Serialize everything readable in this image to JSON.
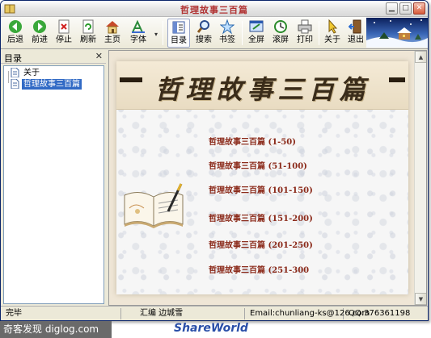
{
  "window": {
    "title": "哲理故事三百篇"
  },
  "toolbar": {
    "back": "后退",
    "forward": "前进",
    "stop": "停止",
    "refresh": "刷新",
    "home": "主页",
    "font": "字体",
    "toc": "目录",
    "search": "搜索",
    "bookmark": "书签",
    "fullscreen": "全屏",
    "autoscroll": "滚屏",
    "print": "打印",
    "about": "关于",
    "exit": "退出"
  },
  "sidebar": {
    "title": "目录",
    "items": [
      {
        "label": "关于"
      },
      {
        "label": "哲理故事三百篇"
      }
    ]
  },
  "content": {
    "banner_title": "哲理故事三百篇",
    "links": [
      "哲理故事三百篇 (1-50)",
      "哲理故事三百篇 (51-100)",
      "哲理故事三百篇 (101-150)",
      "哲理故事三百篇 (151-200)",
      "哲理故事三百篇 (201-250)",
      "哲理故事三百篇 (251-300"
    ]
  },
  "status": {
    "state": "完毕",
    "compiler": "汇编 边城雪",
    "email": "Email:chunliang-ks@126.com",
    "qq": "QQ:376361198"
  },
  "watermark": {
    "left": "奇客发现 diglog.com",
    "center": "ShareWorld"
  },
  "colors": {
    "accent": "#316ac5",
    "link": "#8b2a1a",
    "title": "#b03030"
  }
}
